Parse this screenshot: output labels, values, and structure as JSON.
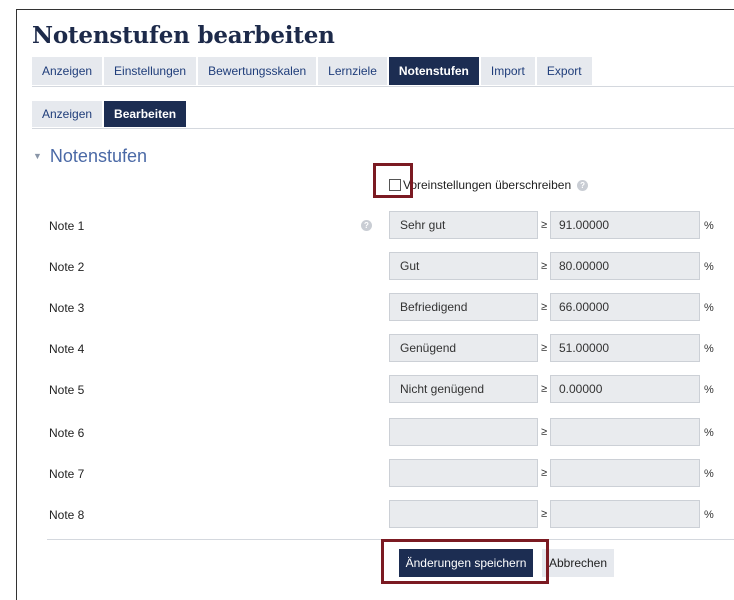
{
  "page": {
    "title": "Notenstufen bearbeiten"
  },
  "tabs": [
    "Anzeigen",
    "Einstellungen",
    "Bewertungsskalen",
    "Lernziele",
    "Notenstufen",
    "Import",
    "Export"
  ],
  "subtabs": [
    "Anzeigen",
    "Bearbeiten"
  ],
  "section": {
    "title": "Notenstufen"
  },
  "override": {
    "label": "Voreinstellungen überschreiben",
    "checked": false
  },
  "ge_symbol": "≥",
  "pct_symbol": "%",
  "grades": [
    {
      "label": "Note 1",
      "name": "Sehr gut",
      "min": "91.00000"
    },
    {
      "label": "Note 2",
      "name": "Gut",
      "min": "80.00000"
    },
    {
      "label": "Note 3",
      "name": "Befriedigend",
      "min": "66.00000"
    },
    {
      "label": "Note 4",
      "name": "Genügend",
      "min": "51.00000"
    },
    {
      "label": "Note 5",
      "name": "Nicht genügend",
      "min": "0.00000"
    },
    {
      "label": "Note 6",
      "name": "",
      "min": ""
    },
    {
      "label": "Note 7",
      "name": "",
      "min": ""
    },
    {
      "label": "Note 8",
      "name": "",
      "min": ""
    }
  ],
  "buttons": {
    "save": "Änderungen speichern",
    "cancel": "Abbrechen"
  },
  "colors": {
    "accent": "#1c2d52",
    "highlight": "#7b1a22",
    "link": "#1f3d7a"
  },
  "icons": {
    "help": "help-circle-icon",
    "caret": "caret-down-icon"
  }
}
